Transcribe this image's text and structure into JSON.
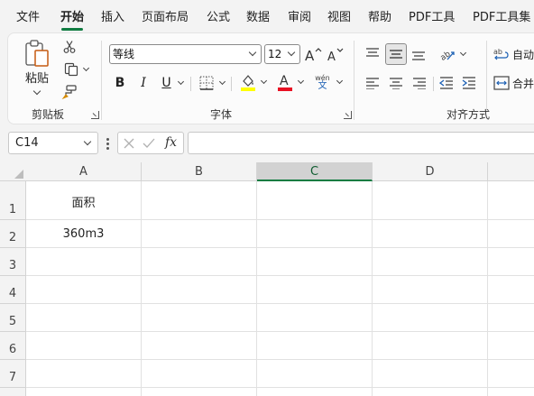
{
  "tabs": [
    "文件",
    "开始",
    "插入",
    "页面布局",
    "公式",
    "数据",
    "审阅",
    "视图",
    "帮助",
    "PDF工具",
    "PDF工具集"
  ],
  "active_tab": "开始",
  "ribbon": {
    "clipboard": {
      "paste_label": "粘贴",
      "group_label": "剪贴板"
    },
    "font": {
      "font_name": "等线",
      "font_size": "12",
      "group_label": "字体",
      "bold": "B",
      "italic": "I",
      "underline": "U",
      "phonetic_top": "wén",
      "phonetic_bottom": "文"
    },
    "alignment": {
      "group_label": "对齐方式",
      "wrap_label": "自动",
      "merge_label": "合并"
    }
  },
  "formula_bar": {
    "name_box": "C14",
    "fx": "fx",
    "formula": ""
  },
  "grid": {
    "columns": [
      "A",
      "B",
      "C",
      "D"
    ],
    "selected_column": "C",
    "rows": [
      "1",
      "2",
      "3",
      "4",
      "5",
      "6",
      "7"
    ],
    "cells": {
      "A1": "面积",
      "A2": "360m3"
    }
  },
  "colors": {
    "accent": "#107c41",
    "font_color_bar": "#e81123",
    "fill_color_bar": "#ffff00"
  }
}
